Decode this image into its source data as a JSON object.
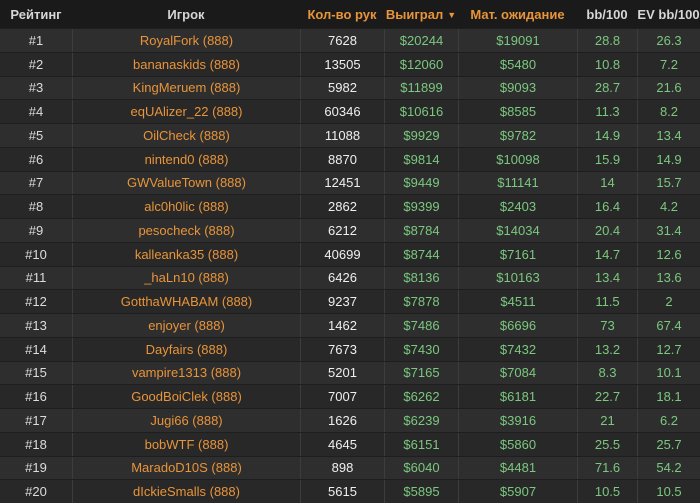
{
  "colors": {
    "accent_orange": "#e8943a",
    "positive_green": "#7bc87f",
    "header_bg": "#1a1a1a",
    "row_bg_odd": "#2e2e2e",
    "row_bg_even": "#282828"
  },
  "table": {
    "sort_icon": "▼",
    "sorted_column": "Выиграл",
    "sort_direction": "desc",
    "columns": [
      {
        "label": "Рейтинг",
        "accent": false
      },
      {
        "label": "Игрок",
        "accent": false
      },
      {
        "label": "Кол-во рук",
        "accent": true
      },
      {
        "label": "Выиграл",
        "accent": true,
        "sorted": "desc"
      },
      {
        "label": "Мат. ожидание",
        "accent": true
      },
      {
        "label": "bb/100",
        "accent": false
      },
      {
        "label": "EV bb/100",
        "accent": false
      }
    ],
    "rows": [
      {
        "rank": "#1",
        "player": "RoyalFork (888)",
        "hands": "7628",
        "won": "$20244",
        "expectation": "$19091",
        "bb100": "28.8",
        "ev_bb100": "26.3"
      },
      {
        "rank": "#2",
        "player": "bananaskids (888)",
        "hands": "13505",
        "won": "$12060",
        "expectation": "$5480",
        "bb100": "10.8",
        "ev_bb100": "7.2"
      },
      {
        "rank": "#3",
        "player": "KingMeruem (888)",
        "hands": "5982",
        "won": "$11899",
        "expectation": "$9093",
        "bb100": "28.7",
        "ev_bb100": "21.6"
      },
      {
        "rank": "#4",
        "player": "eqUAlizer_22 (888)",
        "hands": "60346",
        "won": "$10616",
        "expectation": "$8585",
        "bb100": "11.3",
        "ev_bb100": "8.2"
      },
      {
        "rank": "#5",
        "player": "OilCheck (888)",
        "hands": "11088",
        "won": "$9929",
        "expectation": "$9782",
        "bb100": "14.9",
        "ev_bb100": "13.4"
      },
      {
        "rank": "#6",
        "player": "nintend0 (888)",
        "hands": "8870",
        "won": "$9814",
        "expectation": "$10098",
        "bb100": "15.9",
        "ev_bb100": "14.9"
      },
      {
        "rank": "#7",
        "player": "GWValueTown (888)",
        "hands": "12451",
        "won": "$9449",
        "expectation": "$11141",
        "bb100": "14",
        "ev_bb100": "15.7"
      },
      {
        "rank": "#8",
        "player": "alc0h0lic (888)",
        "hands": "2862",
        "won": "$9399",
        "expectation": "$2403",
        "bb100": "16.4",
        "ev_bb100": "4.2"
      },
      {
        "rank": "#9",
        "player": "pesocheck (888)",
        "hands": "6212",
        "won": "$8784",
        "expectation": "$14034",
        "bb100": "20.4",
        "ev_bb100": "31.4"
      },
      {
        "rank": "#10",
        "player": "kalleanka35 (888)",
        "hands": "40699",
        "won": "$8744",
        "expectation": "$7161",
        "bb100": "14.7",
        "ev_bb100": "12.6"
      },
      {
        "rank": "#11",
        "player": "_haLn10 (888)",
        "hands": "6426",
        "won": "$8136",
        "expectation": "$10163",
        "bb100": "13.4",
        "ev_bb100": "13.6"
      },
      {
        "rank": "#12",
        "player": "GotthaWHABAM (888)",
        "hands": "9237",
        "won": "$7878",
        "expectation": "$4511",
        "bb100": "11.5",
        "ev_bb100": "2"
      },
      {
        "rank": "#13",
        "player": "enjoyer (888)",
        "hands": "1462",
        "won": "$7486",
        "expectation": "$6696",
        "bb100": "73",
        "ev_bb100": "67.4"
      },
      {
        "rank": "#14",
        "player": "Dayfairs (888)",
        "hands": "7673",
        "won": "$7430",
        "expectation": "$7432",
        "bb100": "13.2",
        "ev_bb100": "12.7"
      },
      {
        "rank": "#15",
        "player": "vampire1313 (888)",
        "hands": "5201",
        "won": "$7165",
        "expectation": "$7084",
        "bb100": "8.3",
        "ev_bb100": "10.1"
      },
      {
        "rank": "#16",
        "player": "GoodBoiClek (888)",
        "hands": "7007",
        "won": "$6262",
        "expectation": "$6181",
        "bb100": "22.7",
        "ev_bb100": "18.1"
      },
      {
        "rank": "#17",
        "player": "Jugi66 (888)",
        "hands": "1626",
        "won": "$6239",
        "expectation": "$3916",
        "bb100": "21",
        "ev_bb100": "6.2"
      },
      {
        "rank": "#18",
        "player": "bobWTF (888)",
        "hands": "4645",
        "won": "$6151",
        "expectation": "$5860",
        "bb100": "25.5",
        "ev_bb100": "25.7"
      },
      {
        "rank": "#19",
        "player": "MaradoD10S (888)",
        "hands": "898",
        "won": "$6040",
        "expectation": "$4481",
        "bb100": "71.6",
        "ev_bb100": "54.2"
      },
      {
        "rank": "#20",
        "player": "dIckieSmalls (888)",
        "hands": "5615",
        "won": "$5895",
        "expectation": "$5907",
        "bb100": "10.5",
        "ev_bb100": "10.5"
      }
    ]
  }
}
